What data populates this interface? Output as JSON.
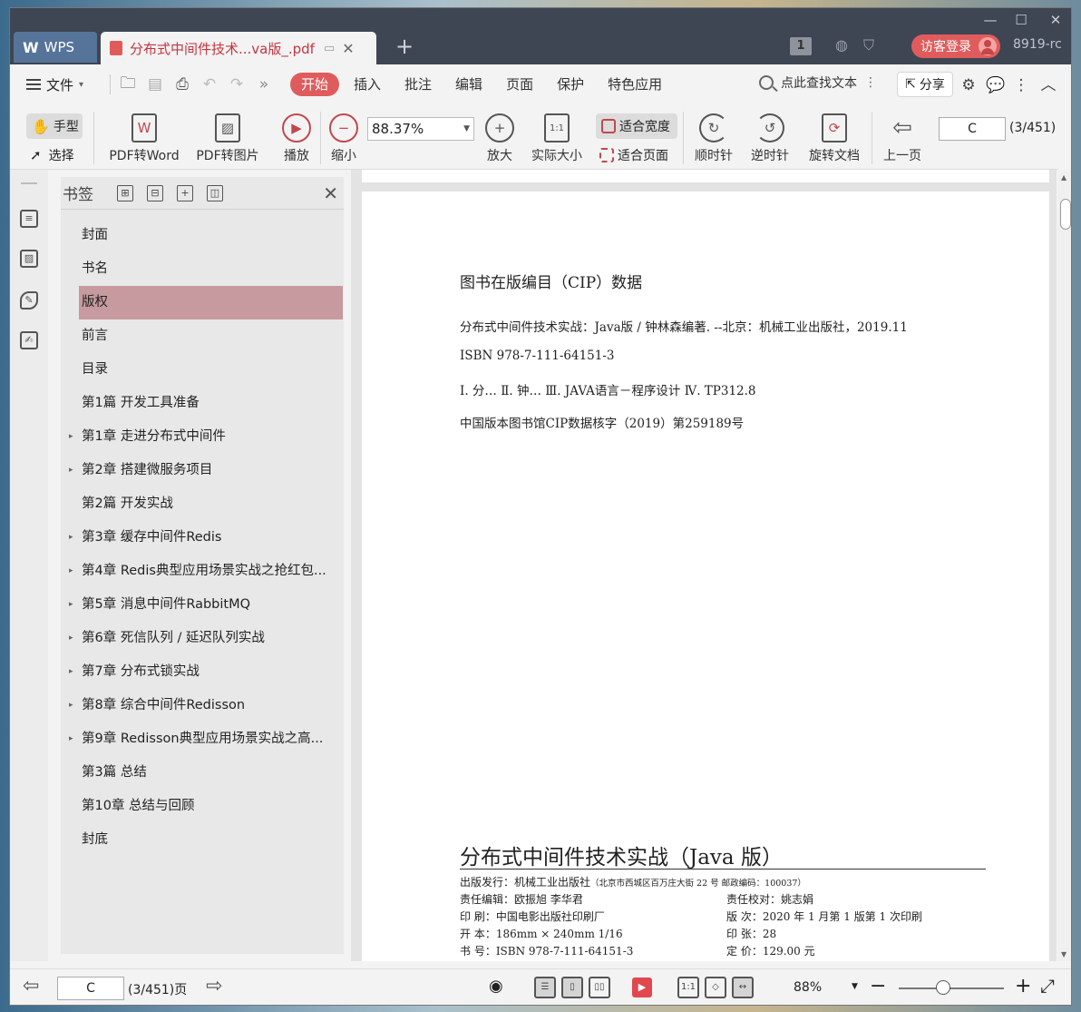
{
  "titlebar": {
    "app_label": "WPS",
    "doc_tab": "分布式中间件技术...va版_.pdf",
    "badge_count": "1",
    "login_label": "访客登录",
    "user_id": "8919-rc"
  },
  "menubar": {
    "file_label": "文件",
    "tabs": [
      "开始",
      "插入",
      "批注",
      "编辑",
      "页面",
      "保护",
      "特色应用"
    ],
    "search_label": "点此查找文本",
    "share_label": "分享"
  },
  "toolbar": {
    "hand_label": "手型",
    "select_label": "选择",
    "pdf_to_word": "PDF转Word",
    "pdf_to_image": "PDF转图片",
    "play": "播放",
    "zoom_out": "缩小",
    "zoom_value": "88.37%",
    "zoom_in": "放大",
    "actual_size": "实际大小",
    "fit_width": "适合宽度",
    "fit_page": "适合页面",
    "rotate_cw": "顺时针",
    "rotate_ccw": "逆时针",
    "rotate_doc": "旋转文档",
    "prev_page": "上一页",
    "page_input": "C",
    "page_count": "(3/451)"
  },
  "bookmarks": {
    "title": "书签",
    "items": [
      {
        "label": "封面",
        "arrow": ""
      },
      {
        "label": "书名",
        "arrow": ""
      },
      {
        "label": "版权",
        "arrow": ""
      },
      {
        "label": "前言",
        "arrow": ""
      },
      {
        "label": "目录",
        "arrow": ""
      },
      {
        "label": "第1篇  开发工具准备",
        "arrow": ""
      },
      {
        "label": "第1章  走进分布式中间件",
        "arrow": "▸"
      },
      {
        "label": "第2章  搭建微服务项目",
        "arrow": "▸"
      },
      {
        "label": "第2篇  开发实战",
        "arrow": ""
      },
      {
        "label": "第3章  缓存中间件Redis",
        "arrow": "▸"
      },
      {
        "label": "第4章  Redis典型应用场景实战之抢红包...",
        "arrow": "▸"
      },
      {
        "label": "第5章  消息中间件RabbitMQ",
        "arrow": "▸"
      },
      {
        "label": "第6章  死信队列 / 延迟队列实战",
        "arrow": "▸"
      },
      {
        "label": "第7章  分布式锁实战",
        "arrow": "▸"
      },
      {
        "label": "第8章  综合中间件Redisson",
        "arrow": "▸"
      },
      {
        "label": "第9章  Redisson典型应用场景实战之高...",
        "arrow": "▸"
      },
      {
        "label": "第3篇  总结",
        "arrow": ""
      },
      {
        "label": "第10章  总结与回顾",
        "arrow": ""
      },
      {
        "label": "封底",
        "arrow": ""
      }
    ],
    "selected_index": 2
  },
  "page": {
    "cip_title": "图书在版编目（CIP）数据",
    "cip_lines": [
      "分布式中间件技术实战：Java版 / 钟林森编著. --北京：机械工业出版社，2019.11",
      "ISBN 978-7-111-64151-3",
      "Ⅰ. 分…  Ⅱ. 钟…  Ⅲ. JAVA语言－程序设计   Ⅳ. TP312.8",
      "中国版本图书馆CIP数据核字（2019）第259189号"
    ],
    "book_title": "分布式中间件技术实战（Java 版）",
    "publisher_label": "出版发行：机械工业出版社",
    "publisher_addr": "（北京市西城区百万庄大街 22 号   邮政编码：100037）",
    "editor": "责任编辑：欧振旭   李华君",
    "proofreader": "责任校对：姚志娟",
    "printer": "印    刷：中国电影出版社印刷厂",
    "edition": "版    次：2020 年 1 月第 1 版第 1 次印刷",
    "format": "开    本：186mm × 240mm   1/16",
    "sheets": "印    张：28",
    "isbn": "书    号：ISBN 978-7-111-64151-3",
    "price": "定    价：129.00 元"
  },
  "statusbar": {
    "page_input": "C",
    "page_count": "(3/451)页",
    "zoom_percent": "88%",
    "zoom_level": 0.42
  }
}
